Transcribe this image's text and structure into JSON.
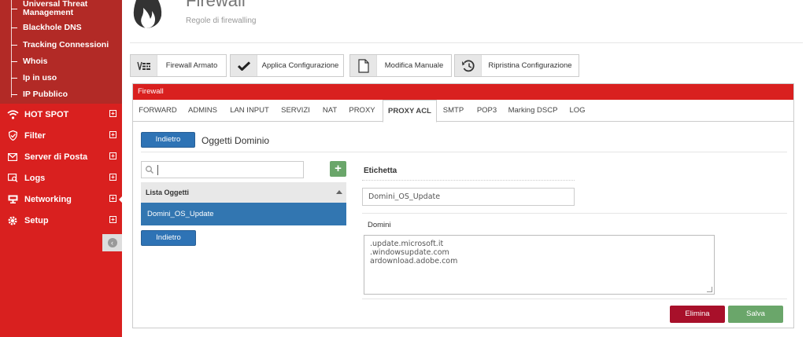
{
  "sidebar": {
    "sub_items": [
      {
        "label": "Universal Threat Management"
      },
      {
        "label": "Blackhole DNS"
      },
      {
        "label": "Tracking Connessioni"
      },
      {
        "label": "Whois"
      },
      {
        "label": "Ip in uso"
      },
      {
        "label": "IP Pubblico"
      }
    ],
    "nav_items": [
      {
        "label": "HOT SPOT",
        "icon": "wifi-icon"
      },
      {
        "label": "Filter",
        "icon": "shield-icon"
      },
      {
        "label": "Server di Posta",
        "icon": "mail-icon"
      },
      {
        "label": "Logs",
        "icon": "search-doc-icon"
      },
      {
        "label": "Networking",
        "icon": "network-icon"
      },
      {
        "label": "Setup",
        "icon": "gear-icon"
      }
    ],
    "expand_symbol": "+",
    "collapse_symbol": "‹"
  },
  "header": {
    "title": "Firewall",
    "subtitle": "Regole di firewalling"
  },
  "toolbar": {
    "buttons": [
      {
        "label": "Firewall Armato",
        "icon": "firewall-armed-icon"
      },
      {
        "label": "Applica Configurazione",
        "icon": "check-icon"
      },
      {
        "label": "Modifica Manuale",
        "icon": "document-icon"
      },
      {
        "label": "Ripristina Configurazione",
        "icon": "restore-icon"
      }
    ]
  },
  "panel": {
    "title": "Firewall",
    "tabs": [
      {
        "label": "FORWARD"
      },
      {
        "label": "ADMINS"
      },
      {
        "label": "LAN INPUT"
      },
      {
        "label": "SERVIZI"
      },
      {
        "label": "NAT"
      },
      {
        "label": "PROXY"
      },
      {
        "label": "PROXY ACL",
        "active": true
      },
      {
        "label": "SMTP"
      },
      {
        "label": "POP3"
      },
      {
        "label": "Marking DSCP"
      },
      {
        "label": "LOG"
      }
    ]
  },
  "content": {
    "back_label": "Indietro",
    "title": "Oggetti Dominio",
    "search": {
      "value": "",
      "placeholder": ""
    },
    "add_label": "+",
    "list_header": "Lista Oggetti",
    "list_items": [
      {
        "label": "Domini_OS_Update"
      }
    ],
    "back_label_bottom": "Indietro"
  },
  "form": {
    "etichetta_label": "Etichetta",
    "etichetta_value": "Domini_OS_Update",
    "domini_label": "Domini",
    "domini_lines": [
      ".update.microsoft.it",
      ".windowsupdate.com",
      "ardownload.adobe.com"
    ],
    "delete_label": "Elimina",
    "save_label": "Salva"
  },
  "colors": {
    "brand_red": "#d9201f",
    "dark_red": "#b22a26",
    "primary_blue": "#2e73b5",
    "success_green": "#6aa66a",
    "danger": "#a8102a"
  }
}
